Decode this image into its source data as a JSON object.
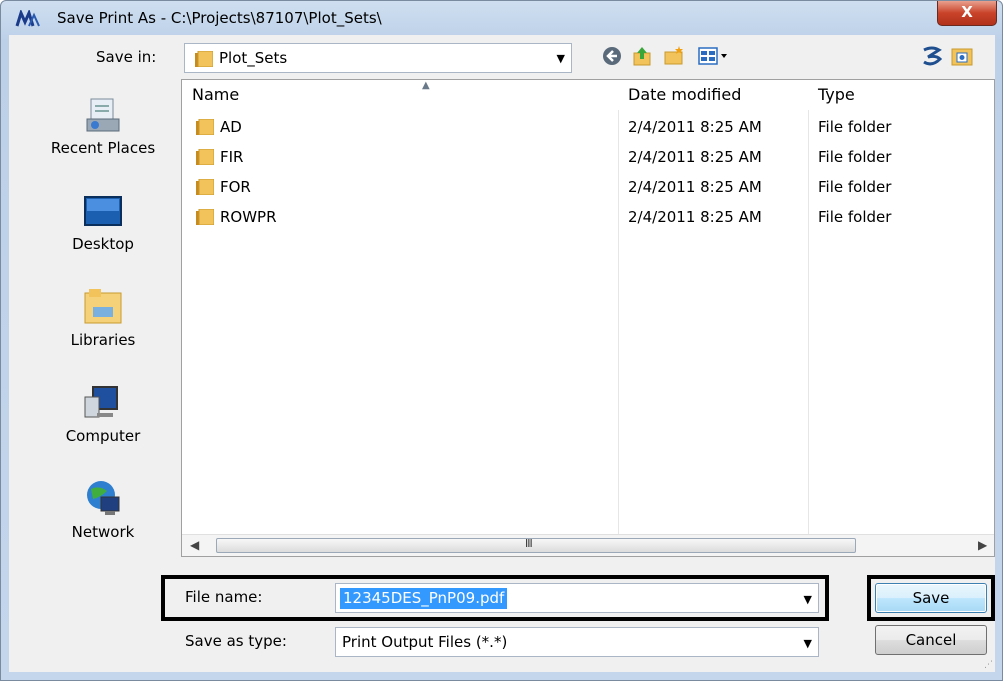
{
  "window": {
    "title": "Save Print As - C:\\Projects\\87107\\Plot_Sets\\",
    "close_label": "X"
  },
  "toolbar": {
    "save_in_label": "Save in:",
    "save_in_value": "Plot_Sets",
    "icons": [
      "back-icon",
      "up-folder-icon",
      "new-folder-icon",
      "views-menu-icon",
      "app-extra-icon",
      "folder-browse-icon"
    ]
  },
  "places": [
    {
      "label": "Recent Places",
      "icon": "recent-places-icon"
    },
    {
      "label": "Desktop",
      "icon": "desktop-icon"
    },
    {
      "label": "Libraries",
      "icon": "libraries-icon"
    },
    {
      "label": "Computer",
      "icon": "computer-icon"
    },
    {
      "label": "Network",
      "icon": "network-icon"
    }
  ],
  "file_list": {
    "columns": [
      "Name",
      "Date modified",
      "Type"
    ],
    "rows": [
      {
        "name": "AD",
        "date": "2/4/2011 8:25 AM",
        "type": "File folder"
      },
      {
        "name": "FIR",
        "date": "2/4/2011 8:25 AM",
        "type": "File folder"
      },
      {
        "name": "FOR",
        "date": "2/4/2011 8:25 AM",
        "type": "File folder"
      },
      {
        "name": "ROWPR",
        "date": "2/4/2011 8:25 AM",
        "type": "File folder"
      }
    ],
    "scroll_grip": "III"
  },
  "form": {
    "file_name_label": "File name:",
    "file_name_value": "12345DES_PnP09.pdf",
    "save_as_type_label": "Save as type:",
    "save_as_type_value": "Print Output Files (*.*)"
  },
  "buttons": {
    "save": "Save",
    "cancel": "Cancel"
  },
  "colors": {
    "selection": "#3399ff",
    "folder": "#e8b64a",
    "highlight_box": "#000000"
  }
}
